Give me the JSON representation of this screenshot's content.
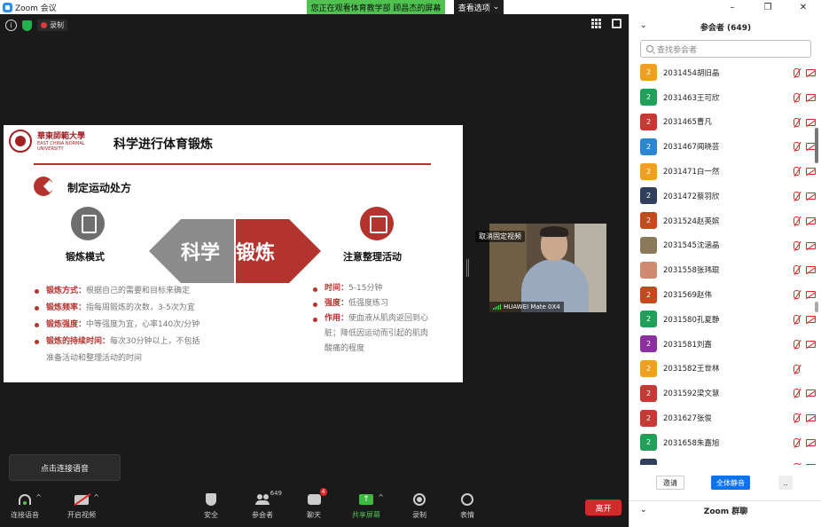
{
  "window": {
    "title": "Zoom 会议",
    "minimize": "–",
    "maximize": "❐",
    "close": "✕"
  },
  "banner": {
    "share_text": "您正在观看体育教学部 顾昌杰的屏幕",
    "view_options": "查看选项"
  },
  "top_bar": {
    "recording_label": "录制"
  },
  "slide": {
    "university_name": "華東師範大學",
    "university_en": "EAST CHINA NORMAL UNIVERSITY",
    "title": "科学进行体育锻炼",
    "section_title": "制定运动处方",
    "left_label": "锻炼模式",
    "right_label": "注意整理活动",
    "arrow_left": "科学",
    "arrow_right": "锻炼",
    "colors": {
      "accent": "#b3342f",
      "gray": "#6e6e6e"
    },
    "left_bullets": [
      {
        "key": "锻炼方式：",
        "text": "根据自己的需要和目标来确定"
      },
      {
        "key": "锻炼频率：",
        "text": "指每周锻炼的次数，3-5次为宜"
      },
      {
        "key": "锻炼强度：",
        "text": "中等强度为宜，心率140次/分钟"
      },
      {
        "key": "锻炼的持续时间：",
        "text": "每次30分钟以上，不包括"
      }
    ],
    "left_bullet_cont": "准备活动和整理活动的时间",
    "right_bullets": [
      {
        "key": "时间：",
        "text": "5-15分钟"
      },
      {
        "key": "强度：",
        "text": "低强度练习"
      },
      {
        "key": "作用：",
        "text": "使血液从肌肉返回到心"
      }
    ],
    "right_cont_1": "脏；降低因运动而引起的肌肉",
    "right_cont_2": "酸痛的程度"
  },
  "video": {
    "unpin_label": "取消固定视频",
    "name": "HUAWEI Mate 0X4"
  },
  "tooltip": {
    "text": "点击连接语音"
  },
  "toolbar": {
    "audio_label": "连接语音",
    "video_label": "开启视频",
    "security_label": "安全",
    "participants_label": "参会者",
    "participants_count": "649",
    "chat_label": "聊天",
    "chat_badge": "4",
    "share_label": "共享屏幕",
    "record_label": "录制",
    "reactions_label": "表情",
    "leave_label": "离开",
    "caret": "^"
  },
  "panel": {
    "title": "参会者 (649)",
    "search_placeholder": "查找参会者",
    "participants": [
      {
        "avatar": "2",
        "color": "#f0a020",
        "name": "2031454胡旧晶",
        "video_off": true
      },
      {
        "avatar": "2",
        "color": "#21a05a",
        "name": "2031463王可欣",
        "video_off": true
      },
      {
        "avatar": "2",
        "color": "#c53a35",
        "name": "2031465曹凡",
        "video_off": true
      },
      {
        "avatar": "2",
        "color": "#2d86d1",
        "name": "2031467闻晓芸",
        "video_off": true
      },
      {
        "avatar": "2",
        "color": "#f0a020",
        "name": "2031471白一然",
        "video_off": true
      },
      {
        "avatar": "2",
        "color": "#2f3f5c",
        "name": "2031472蔡羽欣",
        "video_off": true
      },
      {
        "avatar": "2",
        "color": "#c24a1c",
        "name": "2031524赵英嫔",
        "video_off": true
      },
      {
        "avatar": "",
        "color": "#8a7a5a",
        "name": "2031545沈涵晶",
        "video_off": true
      },
      {
        "avatar": "",
        "color": "#d08a70",
        "name": "2031558张玮琨",
        "video_off": true
      },
      {
        "avatar": "2",
        "color": "#c24a1c",
        "name": "2031569赵伟",
        "video_off": true
      },
      {
        "avatar": "2",
        "color": "#21a05a",
        "name": "2031580孔夏静",
        "video_off": true
      },
      {
        "avatar": "2",
        "color": "#8e2fa0",
        "name": "2031581刘嘉",
        "video_off": true
      },
      {
        "avatar": "2",
        "color": "#f0a020",
        "name": "2031582王世林",
        "video_off": false
      },
      {
        "avatar": "2",
        "color": "#c53a35",
        "name": "2031592梁文慧",
        "video_off": true
      },
      {
        "avatar": "2",
        "color": "#c53a35",
        "name": "2031627张俊",
        "video_off": true
      },
      {
        "avatar": "2",
        "color": "#21a05a",
        "name": "2031658朱嘉旭",
        "video_off": true
      },
      {
        "avatar": "",
        "color": "#2f3f5c",
        "name": "",
        "video_off": true
      }
    ],
    "invite_label": "邀请",
    "mute_all_label": "全体静音",
    "more_label": "..",
    "chat_title": "Zoom 群聊",
    "chevron": "⌄"
  }
}
